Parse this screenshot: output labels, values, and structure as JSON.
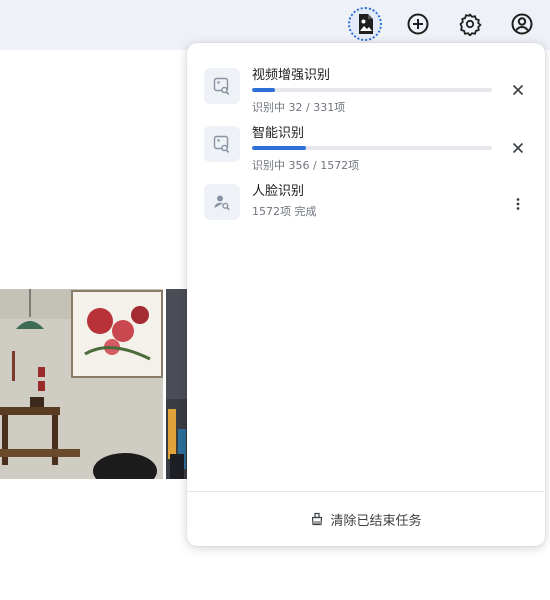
{
  "topbar": {
    "buttons": [
      {
        "icon": "media-task-icon",
        "active": true
      },
      {
        "icon": "add-icon"
      },
      {
        "icon": "settings-icon"
      },
      {
        "icon": "account-icon"
      }
    ]
  },
  "panel": {
    "tasks": [
      {
        "title": "视频增强识别",
        "status": "识别中 32 / 331项",
        "progress": 0.097,
        "thumb_icon": "image-search-icon",
        "action_icon": "close-icon"
      },
      {
        "title": "智能识别",
        "status": "识别中 356 / 1572项",
        "progress": 0.226,
        "thumb_icon": "image-search-icon",
        "action_icon": "close-icon"
      },
      {
        "title": "人脸识别",
        "status": "1572项 完成",
        "thumb_icon": "face-search-icon",
        "action_icon": "more-vert-icon"
      }
    ],
    "footer": {
      "label": "清除已结束任务",
      "icon": "broom-icon"
    }
  },
  "colors": {
    "accent": "#2f6fd6",
    "topbar_bg": "#eef1f7",
    "progress_track": "#e5e7eb"
  }
}
